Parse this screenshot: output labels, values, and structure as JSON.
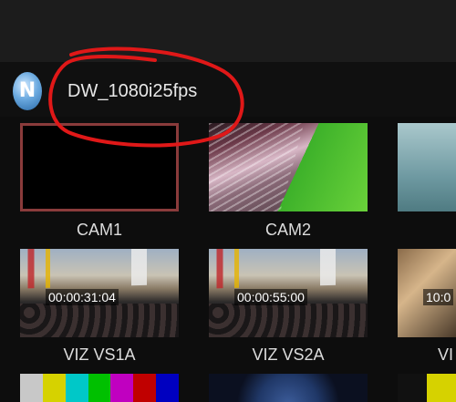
{
  "session": {
    "name": "DW_1080i25fps"
  },
  "sources_row1": [
    {
      "label": "CAM1"
    },
    {
      "label": "CAM2"
    },
    {
      "label": ""
    }
  ],
  "sources_row2": [
    {
      "label": "VIZ VS1A",
      "timecode": "00:00:31:04"
    },
    {
      "label": "VIZ VS2A",
      "timecode": "00:00:55:00"
    },
    {
      "label": "VI",
      "timecode": "10:0"
    }
  ],
  "colors": {
    "background": "#0d0d0d",
    "topbar": "#1c1c1c",
    "selected_border": "#8a3b3b",
    "annotation_red": "#e01818"
  },
  "icons": {
    "logo": "newtek-logo-icon"
  }
}
